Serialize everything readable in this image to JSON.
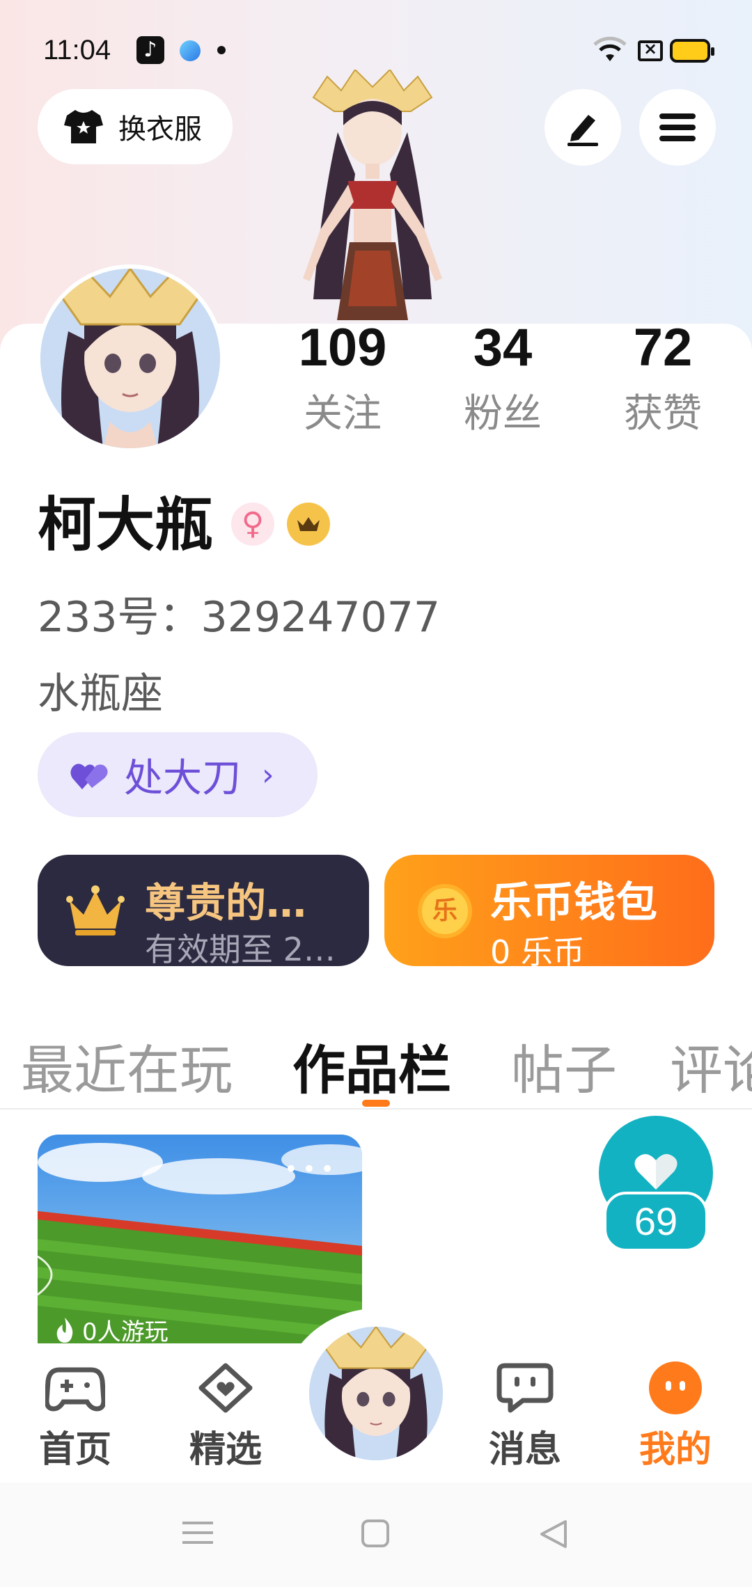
{
  "status_bar": {
    "time": "11:04"
  },
  "header": {
    "outfit_button_label": "换衣服"
  },
  "profile": {
    "stats": [
      {
        "value": "109",
        "label": "关注"
      },
      {
        "value": "34",
        "label": "粉丝"
      },
      {
        "value": "72",
        "label": "获赞"
      }
    ],
    "username": "柯大瓶",
    "gender_symbol": "♀",
    "user_id": "233号：329247077",
    "signature": "水瓶座",
    "tag": {
      "label": "处大刀",
      "chevron": "›"
    }
  },
  "cards": {
    "vip": {
      "title": "尊贵的…",
      "subtitle": "有效期至 2…"
    },
    "wallet": {
      "coin_glyph": "乐",
      "title": "乐币钱包",
      "subtitle": "0 乐币"
    }
  },
  "tabs": [
    {
      "label": "最近在玩",
      "active": false
    },
    {
      "label": "作品栏",
      "active": true
    },
    {
      "label": "帖子",
      "active": false
    },
    {
      "label": "评论",
      "active": false
    }
  ],
  "works": {
    "game": {
      "plays_label": "0人游玩",
      "more": "•••"
    },
    "likes": "69"
  },
  "bottom_nav": [
    {
      "label": "首页",
      "icon": "gamepad-icon"
    },
    {
      "label": "精选",
      "icon": "heart-chat-icon"
    },
    {
      "label": "",
      "icon": "avatar-center"
    },
    {
      "label": "消息",
      "icon": "message-icon"
    },
    {
      "label": "我的",
      "icon": "mine-icon",
      "active": true
    }
  ],
  "colors": {
    "accent": "#ff7a1a",
    "tag_purple": "#6d4fd8",
    "vip_dark": "#2c2a40",
    "vip_gold": "#f6c580",
    "like_teal": "#13b2c2"
  }
}
